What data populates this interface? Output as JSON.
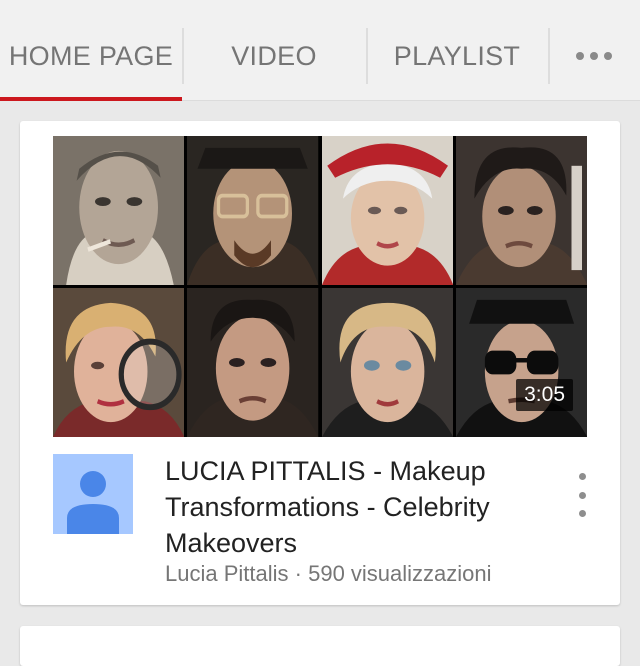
{
  "tabs": [
    {
      "label": "HOME PAGE",
      "active": true
    },
    {
      "label": "VIDEO",
      "active": false
    },
    {
      "label": "PLAYLIST",
      "active": false
    }
  ],
  "more_icon": "more-horizontal-icon",
  "accent_color": "#cc181e",
  "video": {
    "duration": "3:05",
    "title": "LUCIA PITTALIS - Makeup Transformations - Celebrity Makeovers",
    "channel": "Lucia Pittalis",
    "separator": "·",
    "views": "590 visualizzazioni",
    "menu_icon": "more-vertical-icon",
    "channel_avatar_icon": "default-avatar-icon",
    "thumbnail_faces": 8
  }
}
